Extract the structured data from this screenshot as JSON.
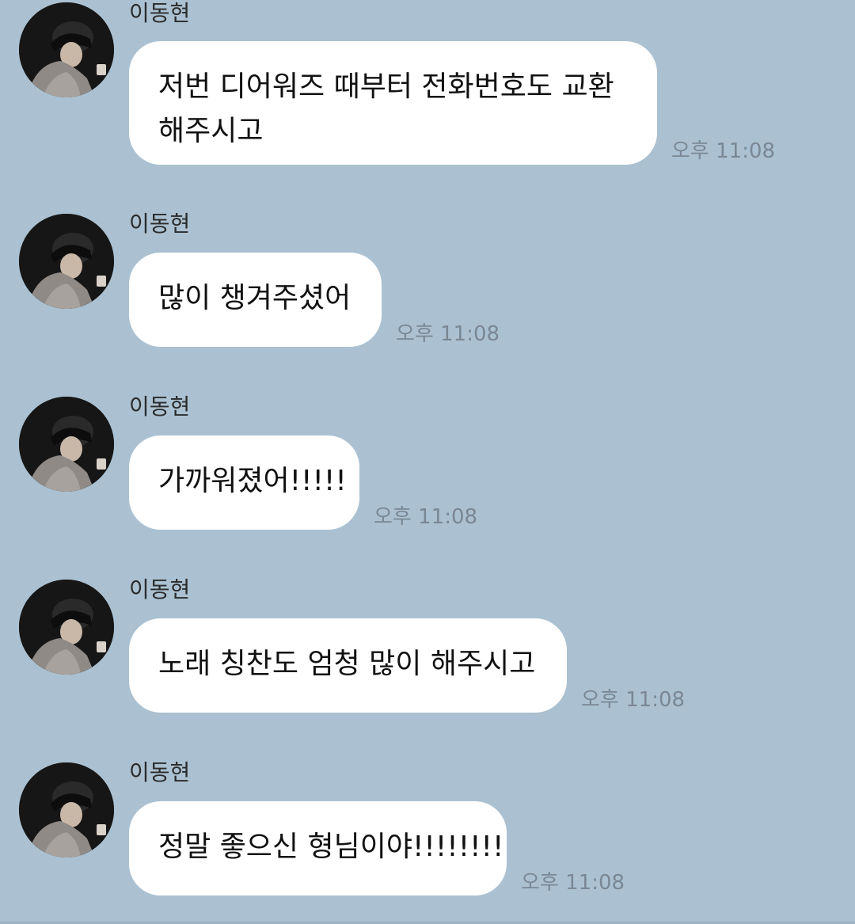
{
  "colors": {
    "background": "#abc1d1",
    "bubble": "#ffffff",
    "time_text": "#7a8794",
    "name_text": "#2b2b2b"
  },
  "messages": [
    {
      "sender": "이동현",
      "avatar_icon": "profile-photo",
      "lines": [
        "저번 디어워즈 때부터 전화번호도 교환",
        "해주시고"
      ],
      "time": "오후 11:08"
    },
    {
      "sender": "이동현",
      "avatar_icon": "profile-photo",
      "lines": [
        "많이 챙겨주셨어"
      ],
      "time": "오후 11:08"
    },
    {
      "sender": "이동현",
      "avatar_icon": "profile-photo",
      "lines": [
        "가까워졌어!!!!!"
      ],
      "time": "오후 11:08"
    },
    {
      "sender": "이동현",
      "avatar_icon": "profile-photo",
      "lines": [
        "노래 칭찬도 엄청 많이 해주시고"
      ],
      "time": "오후 11:08"
    },
    {
      "sender": "이동현",
      "avatar_icon": "profile-photo",
      "lines": [
        "정말 좋으신 형님이야!!!!!!!!"
      ],
      "time": "오후 11:08"
    }
  ]
}
